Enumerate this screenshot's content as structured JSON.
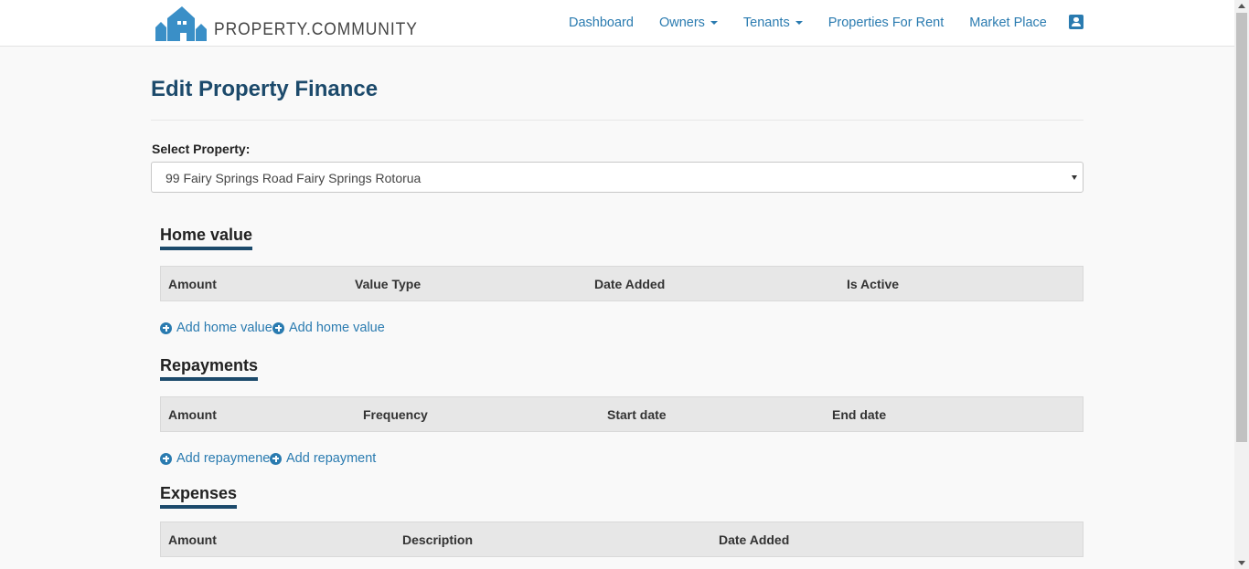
{
  "brand": {
    "name": "PROPERTY.COMMUNITY",
    "color": "#3a8fc7"
  },
  "nav": {
    "dashboard": "Dashboard",
    "owners": "Owners",
    "tenants": "Tenants",
    "properties_for_rent": "Properties For Rent",
    "market_place": "Market Place",
    "profile_icon": "user-card-icon"
  },
  "page": {
    "title": "Edit Property Finance"
  },
  "property_select": {
    "label": "Select Property:",
    "value": "99 Fairy Springs Road Fairy Springs Rotorua"
  },
  "home_value": {
    "title": "Home value",
    "columns": [
      "Amount",
      "Value Type",
      "Date Added",
      "Is Active"
    ],
    "add_links": [
      "Add home value",
      "Add home value"
    ]
  },
  "repayments": {
    "title": "Repayments",
    "columns": [
      "Amount",
      "Frequency",
      "Start date",
      "End date"
    ],
    "add_links": [
      "Add repaymene",
      "Add repayment"
    ]
  },
  "expenses": {
    "title": "Expenses",
    "columns": [
      "Amount",
      "Description",
      "Date Added"
    ]
  },
  "colors": {
    "link": "#2a7bb0",
    "heading": "#1c4a6b",
    "table_header_bg": "#e7e7e7"
  }
}
